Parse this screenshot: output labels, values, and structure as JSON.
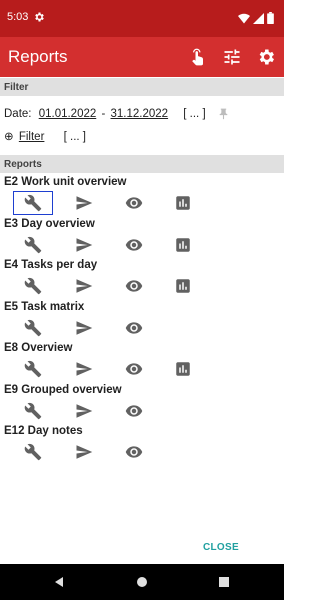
{
  "status": {
    "time": "5:03"
  },
  "app_bar": {
    "title": "Reports"
  },
  "filter": {
    "header": "Filter",
    "date_label": "Date:",
    "date_from": "01.01.2022",
    "date_sep": "-",
    "date_to": "31.12.2022",
    "date_more": "[ ... ]",
    "filter_link": "Filter",
    "filter_more": "[ ... ]"
  },
  "reports": {
    "header": "Reports",
    "items": [
      {
        "title": "E2 Work unit overview",
        "actions": [
          "wrench-icon",
          "send-icon",
          "eye-icon",
          "chart-icon"
        ]
      },
      {
        "title": "E3 Day overview",
        "actions": [
          "wrench-icon",
          "send-icon",
          "eye-icon",
          "chart-icon"
        ]
      },
      {
        "title": "E4 Tasks per day",
        "actions": [
          "wrench-icon",
          "send-icon",
          "eye-icon",
          "chart-icon"
        ]
      },
      {
        "title": "E5 Task matrix",
        "actions": [
          "wrench-icon",
          "send-icon",
          "eye-icon"
        ]
      },
      {
        "title": "E8 Overview",
        "actions": [
          "wrench-icon",
          "send-icon",
          "eye-icon",
          "chart-icon"
        ]
      },
      {
        "title": "E9 Grouped overview",
        "actions": [
          "wrench-icon",
          "send-icon",
          "eye-icon"
        ]
      },
      {
        "title": "E12 Day notes",
        "actions": [
          "wrench-icon",
          "send-icon",
          "eye-icon"
        ]
      }
    ]
  },
  "close_label": "CLOSE",
  "colors": {
    "status_bar": "#b71c1c",
    "app_bar": "#d32f2f",
    "accent": "#20a0a0",
    "icon": "#616161"
  }
}
